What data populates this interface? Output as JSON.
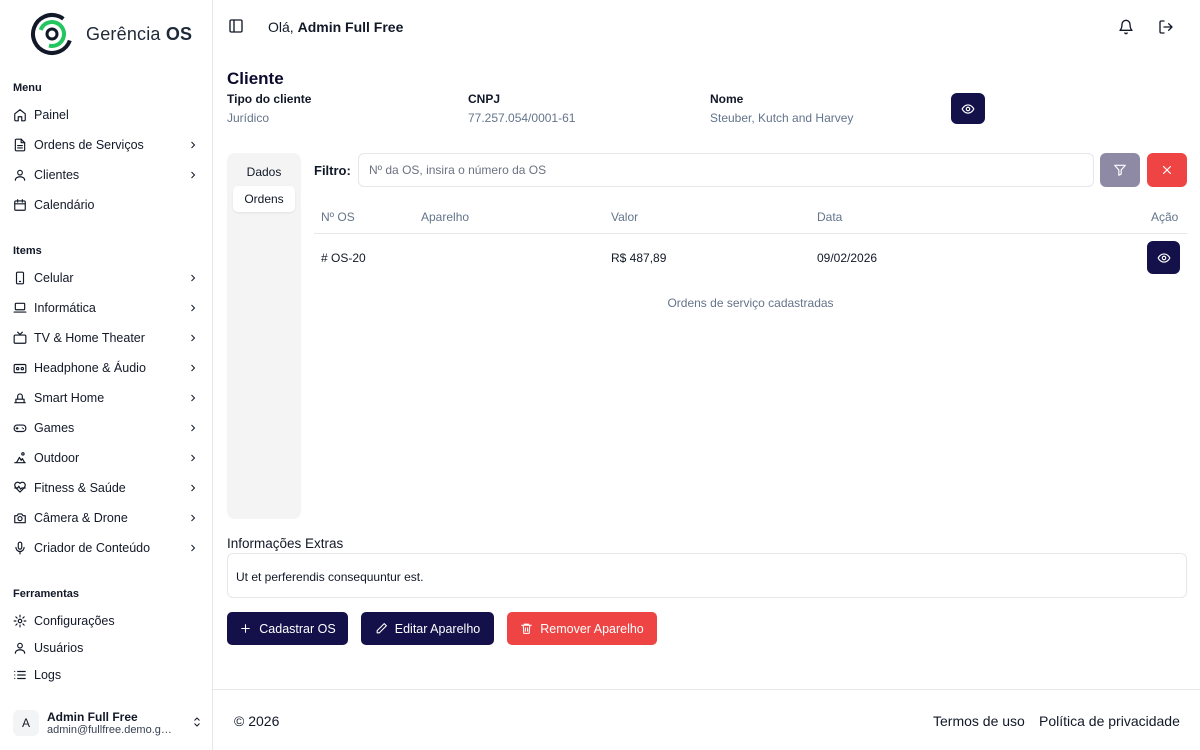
{
  "brand": {
    "name_light": "Gerência",
    "name_bold": "OS",
    "accent": "#22c55e",
    "logo_dark": "#111827"
  },
  "sidebar": {
    "menu_label": "Menu",
    "items_label": "Items",
    "tools_label": "Ferramentas",
    "menu": [
      {
        "label": "Painel",
        "icon": "home-icon",
        "chevron": false
      },
      {
        "label": "Ordens de Serviços",
        "icon": "file-icon",
        "chevron": true
      },
      {
        "label": "Clientes",
        "icon": "user-icon",
        "chevron": true
      },
      {
        "label": "Calendário",
        "icon": "calendar-icon",
        "chevron": false
      }
    ],
    "items": [
      {
        "label": "Celular",
        "icon": "smartphone-icon"
      },
      {
        "label": "Informática",
        "icon": "laptop-icon"
      },
      {
        "label": "TV & Home Theater",
        "icon": "tv-icon"
      },
      {
        "label": "Headphone & Áudio",
        "icon": "speaker-icon"
      },
      {
        "label": "Smart Home",
        "icon": "smart-home-icon"
      },
      {
        "label": "Games",
        "icon": "gamepad-icon"
      },
      {
        "label": "Outdoor",
        "icon": "outdoor-icon"
      },
      {
        "label": "Fitness & Saúde",
        "icon": "heart-pulse-icon"
      },
      {
        "label": "Câmera & Drone",
        "icon": "camera-icon"
      },
      {
        "label": "Criador de Conteúdo",
        "icon": "mic-icon"
      }
    ],
    "tools": [
      {
        "label": "Configurações",
        "icon": "gear-icon"
      },
      {
        "label": "Usuários",
        "icon": "user-icon"
      },
      {
        "label": "Logs",
        "icon": "list-icon"
      }
    ],
    "user": {
      "initial": "A",
      "name": "Admin Full Free",
      "email": "admin@fullfree.demo.ger..."
    }
  },
  "header": {
    "greeting": "Olá,",
    "user_name": "Admin Full Free"
  },
  "client": {
    "title": "Cliente",
    "type_label": "Tipo do cliente",
    "type_value": "Jurídico",
    "cnpj_label": "CNPJ",
    "cnpj_value": "77.257.054/0001-61",
    "name_label": "Nome",
    "name_value": "Steuber, Kutch and Harvey"
  },
  "tabs": {
    "dados": "Dados",
    "ordens": "Ordens"
  },
  "filter": {
    "label": "Filtro:",
    "placeholder": "Nº da OS, insira o número da OS"
  },
  "table": {
    "headers": {
      "num": "Nº OS",
      "device": "Aparelho",
      "value": "Valor",
      "date": "Data",
      "action": "Ação"
    },
    "rows": [
      {
        "num": "# OS-20",
        "device": "",
        "value": "R$ 487,89",
        "date": "09/02/2026"
      }
    ],
    "caption": "Ordens de serviço cadastradas"
  },
  "extras": {
    "title": "Informações Extras",
    "text": "Ut et perferendis consequuntur est."
  },
  "actions": {
    "create": "Cadastrar OS",
    "edit": "Editar Aparelho",
    "remove": "Remover Aparelho"
  },
  "colors": {
    "dark": "#13104a",
    "danger": "#ef4444",
    "muted_button": "#8e8aa6"
  },
  "footer": {
    "copyright": "© 2026",
    "terms": "Termos de uso",
    "privacy": "Política de privacidade"
  }
}
